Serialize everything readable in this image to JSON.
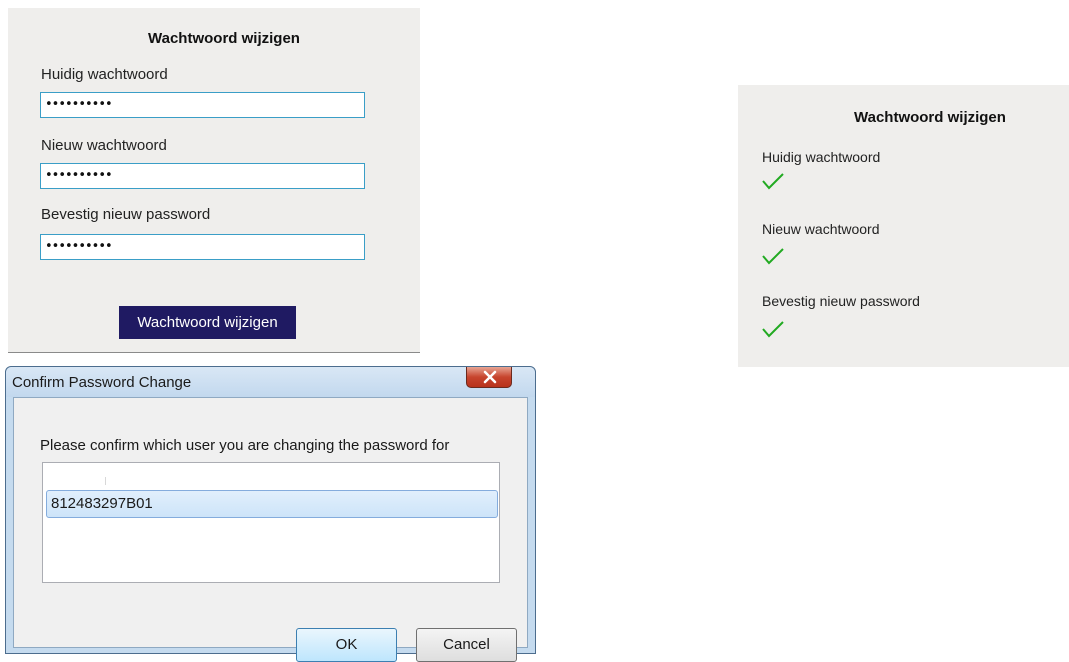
{
  "change_form": {
    "title": "Wachtwoord wijzigen",
    "fields": [
      {
        "label": "Huidig wachtwoord",
        "value": "••••••••••"
      },
      {
        "label": "Nieuw wachtwoord",
        "value": "••••••••••"
      },
      {
        "label": "Bevestig nieuw password",
        "value": "••••••••••"
      }
    ],
    "submit_label": "Wachtwoord wijzigen"
  },
  "result_panel": {
    "title": "Wachtwoord wijzigen",
    "items": [
      {
        "label": "Huidig wachtwoord",
        "status_icon": "checkmark-icon"
      },
      {
        "label": "Nieuw wachtwoord",
        "status_icon": "checkmark-icon"
      },
      {
        "label": "Bevestig nieuw password",
        "status_icon": "checkmark-icon"
      }
    ],
    "check_color": "#22aa22"
  },
  "dialog": {
    "title": "Confirm Password Change",
    "close_icon": "close-icon",
    "prompt": "Please confirm which user you are changing the password for",
    "users": [
      "812483297B01"
    ],
    "ok_label": "OK",
    "cancel_label": "Cancel"
  },
  "colors": {
    "panel_bg": "#efeeec",
    "input_border": "#3a9ec7",
    "submit_bg": "#1f1a62",
    "dialog_frame": "#c5dbef",
    "close_button": "#c7452e"
  }
}
